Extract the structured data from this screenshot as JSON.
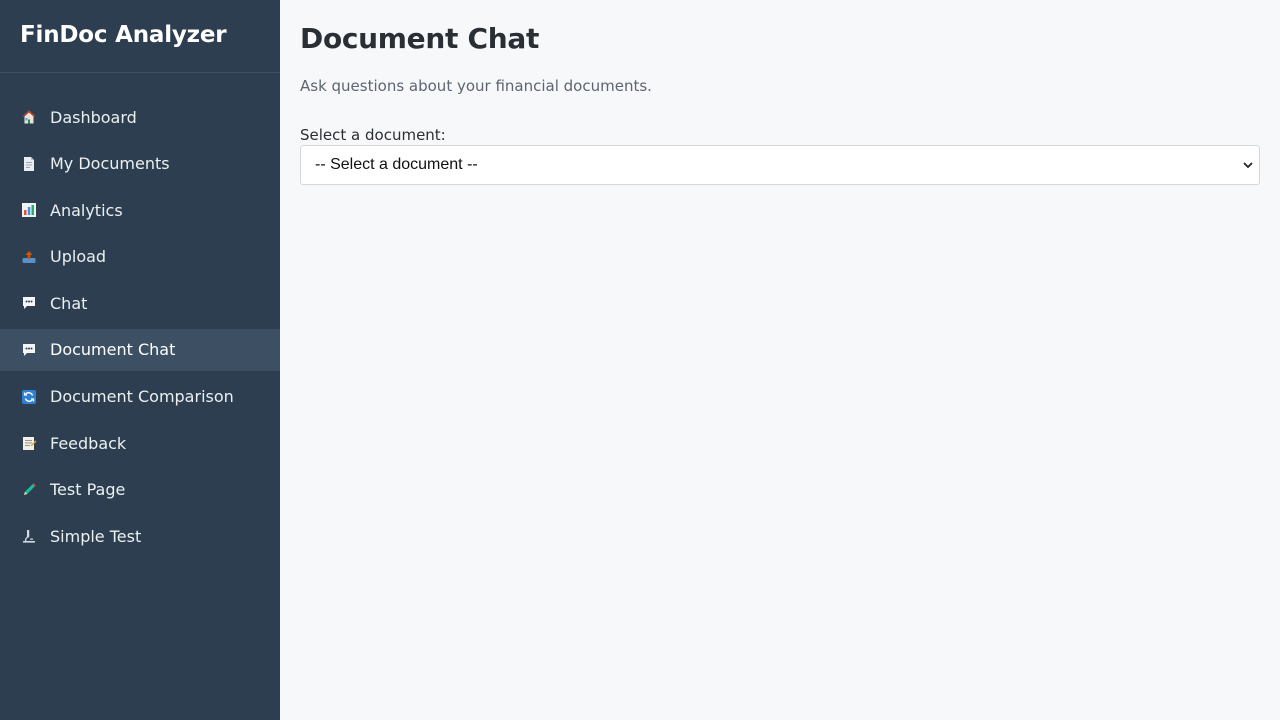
{
  "app": {
    "brand": "FinDoc Analyzer"
  },
  "sidebar": {
    "items": [
      {
        "label": "Dashboard",
        "icon": "home-icon"
      },
      {
        "label": "My Documents",
        "icon": "document-icon"
      },
      {
        "label": "Analytics",
        "icon": "bar-chart-icon"
      },
      {
        "label": "Upload",
        "icon": "upload-icon"
      },
      {
        "label": "Chat",
        "icon": "chat-bubble-icon"
      },
      {
        "label": "Document Chat",
        "icon": "chat-bubble-icon",
        "active": true
      },
      {
        "label": "Document Comparison",
        "icon": "refresh-icon"
      },
      {
        "label": "Feedback",
        "icon": "memo-icon"
      },
      {
        "label": "Test Page",
        "icon": "pencil-icon"
      },
      {
        "label": "Simple Test",
        "icon": "microscope-icon"
      }
    ]
  },
  "main": {
    "title": "Document Chat",
    "subtitle": "Ask questions about your financial documents.",
    "select_label": "Select a document:",
    "select_value": "-- Select a document --"
  },
  "colors": {
    "sidebar_bg": "#2c3e50",
    "sidebar_active": "#3d5063",
    "main_bg": "#f7f8fa"
  }
}
